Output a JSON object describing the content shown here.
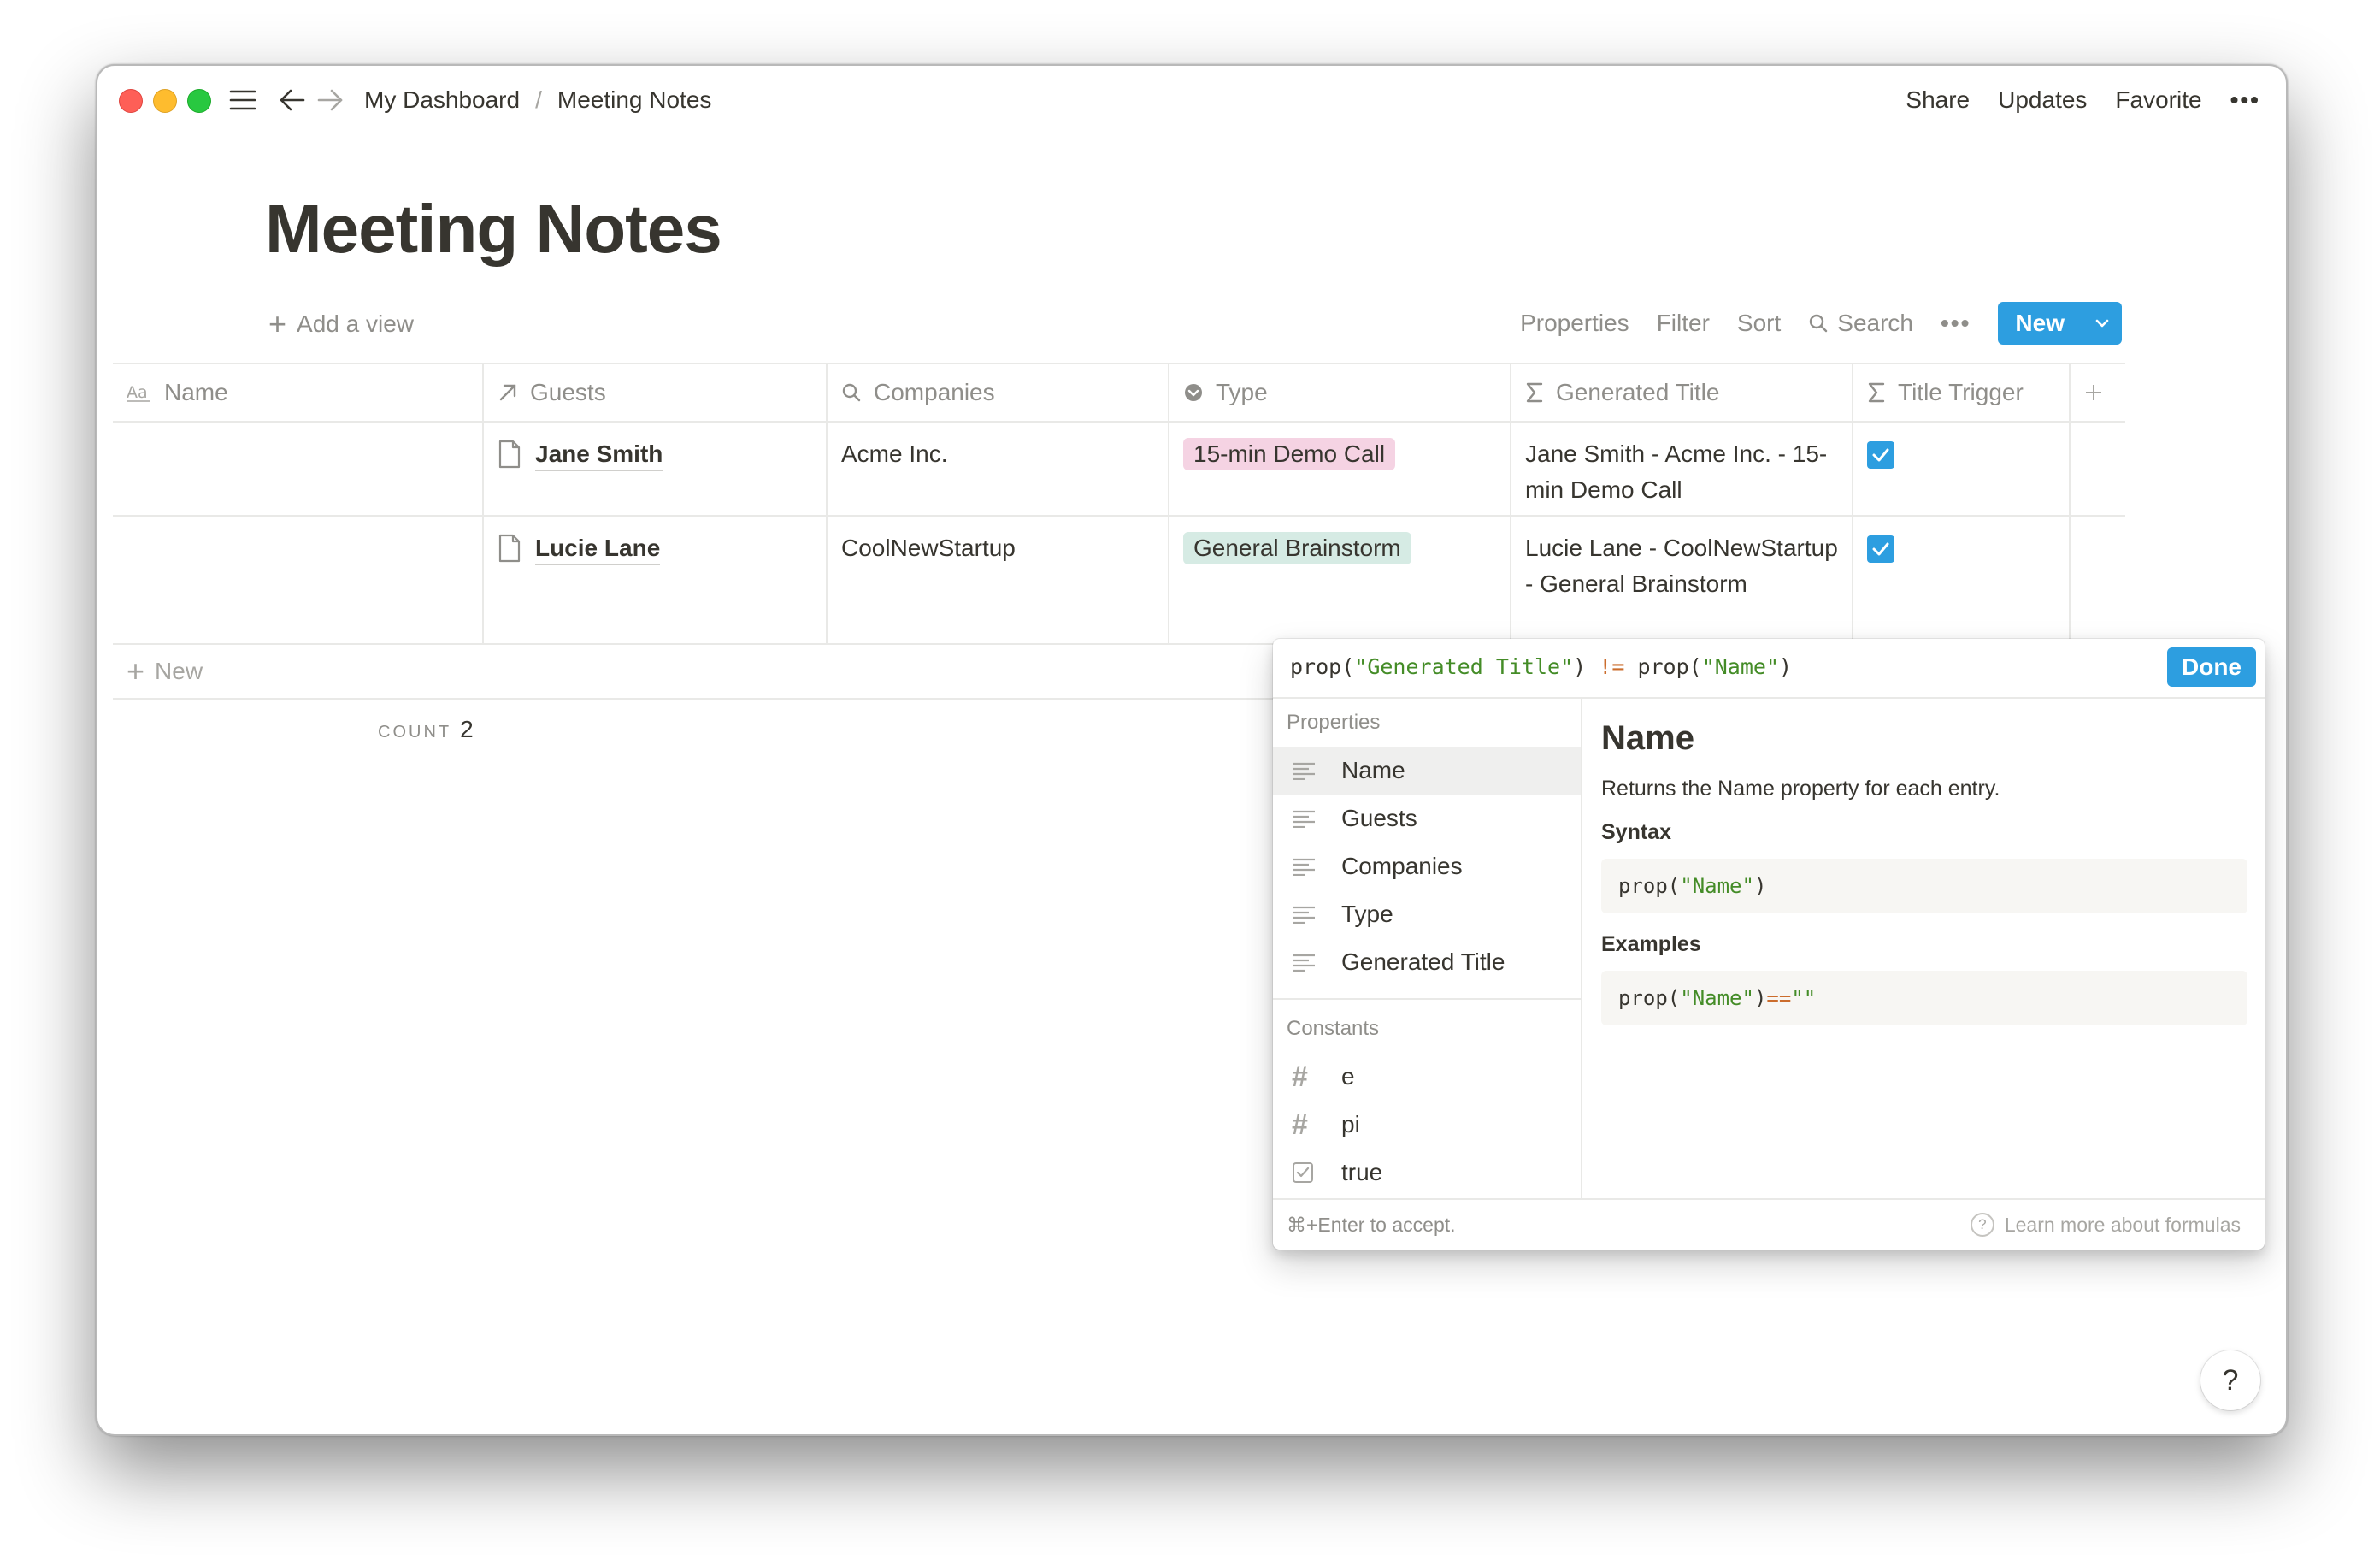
{
  "breadcrumb": {
    "parent": "My Dashboard",
    "separator": "/",
    "current": "Meeting Notes"
  },
  "topbar": {
    "share": "Share",
    "updates": "Updates",
    "favorite": "Favorite",
    "more": "•••"
  },
  "page": {
    "title": "Meeting Notes"
  },
  "views": {
    "add_view": "Add a view"
  },
  "toolbar": {
    "properties": "Properties",
    "filter": "Filter",
    "sort": "Sort",
    "search": "Search",
    "more": "•••",
    "new": "New"
  },
  "table": {
    "columns": [
      {
        "label": "Name",
        "icon": "text-aa-icon"
      },
      {
        "label": "Guests",
        "icon": "relation-arrow-icon"
      },
      {
        "label": "Companies",
        "icon": "search-icon"
      },
      {
        "label": "Type",
        "icon": "select-icon"
      },
      {
        "label": "Generated Title",
        "icon": "sigma-icon"
      },
      {
        "label": "Title Trigger",
        "icon": "sigma-icon"
      }
    ],
    "rows": [
      {
        "name": "",
        "guest": "Jane Smith",
        "company": "Acme Inc.",
        "type": "15-min Demo Call",
        "type_color": "#f5d3e3",
        "generated_title": "Jane Smith - Acme Inc. - 15-min Demo Call",
        "title_trigger": true
      },
      {
        "name": "",
        "guest": "Lucie Lane",
        "company": "CoolNewStartup",
        "type": "General Brainstorm",
        "type_color": "#d6ebe4",
        "generated_title": "Lucie Lane - CoolNewStartup - General Brainstorm",
        "title_trigger": true
      }
    ],
    "new_row": "New",
    "count_label": "COUNT",
    "count_value": "2"
  },
  "formula_editor": {
    "formula_parts": {
      "fn1": "prop(",
      "arg1": "\"Generated Title\"",
      "close1": ")",
      "op": "!=",
      "fn2": "prop(",
      "arg2": "\"Name\"",
      "close2": ")"
    },
    "done": "Done",
    "properties_header": "Properties",
    "properties": [
      "Name",
      "Guests",
      "Companies",
      "Type",
      "Generated Title"
    ],
    "selected_property": "Name",
    "constants_header": "Constants",
    "constants": [
      "e",
      "pi",
      "true"
    ],
    "detail": {
      "title": "Name",
      "description": "Returns the Name property for each entry.",
      "syntax_label": "Syntax",
      "syntax": {
        "fn": "prop(",
        "arg": "\"Name\"",
        "close": ")"
      },
      "examples_label": "Examples",
      "example": {
        "fn": "prop(",
        "arg": "\"Name\"",
        "close": ")",
        "op": "==",
        "empty": "\"\""
      }
    },
    "footer_hint": "⌘+Enter to accept.",
    "learn_more": "Learn more about formulas"
  },
  "help": "?",
  "colors": {
    "accent": "#2d9ee0",
    "text": "#37352f",
    "muted": "#8f8e8a",
    "string": "#448c27",
    "operator": "#cb6c2c"
  }
}
